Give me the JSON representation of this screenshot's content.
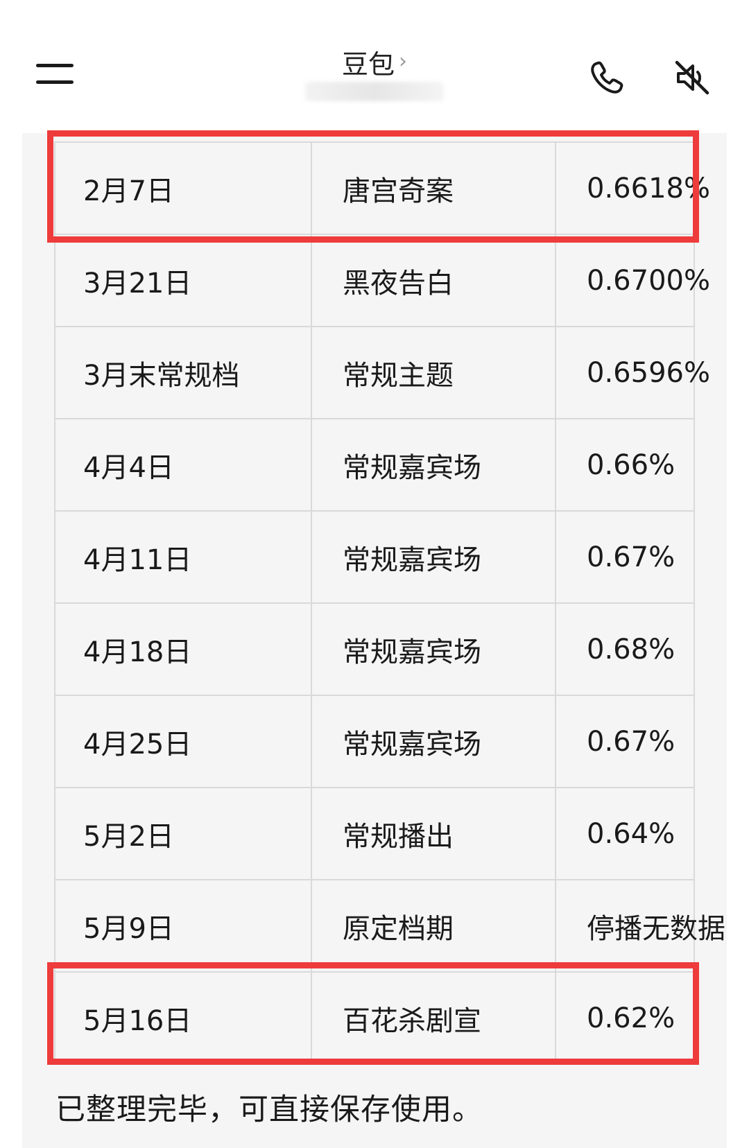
{
  "header": {
    "title": "豆包",
    "title_chevron": "›",
    "menu_icon": "menu-icon",
    "phone_icon": "phone-icon",
    "mute_icon": "speaker-muted-icon"
  },
  "table": {
    "rows": [
      {
        "date": "2月7日",
        "program": "唐宫奇案",
        "rating": "0.6618%"
      },
      {
        "date": "3月21日",
        "program": "黑夜告白",
        "rating": "0.6700%"
      },
      {
        "date": "3月末常规档",
        "program": "常规主题",
        "rating": "0.6596%"
      },
      {
        "date": "4月4日",
        "program": "常规嘉宾场",
        "rating": "0.66%"
      },
      {
        "date": "4月11日",
        "program": "常规嘉宾场",
        "rating": "0.67%"
      },
      {
        "date": "4月18日",
        "program": "常规嘉宾场",
        "rating": "0.68%"
      },
      {
        "date": "4月25日",
        "program": "常规嘉宾场",
        "rating": "0.67%"
      },
      {
        "date": "5月2日",
        "program": "常规播出",
        "rating": "0.64%"
      },
      {
        "date": "5月9日",
        "program": "原定档期",
        "rating": "停播无数据"
      },
      {
        "date": "5月16日",
        "program": "百花杀剧宣",
        "rating": "0.62%"
      }
    ],
    "highlighted_rows": [
      0,
      9
    ],
    "highlight_color": "#ee3b3b"
  },
  "message": {
    "closing_text": "已整理完毕，可直接保存使用。"
  }
}
